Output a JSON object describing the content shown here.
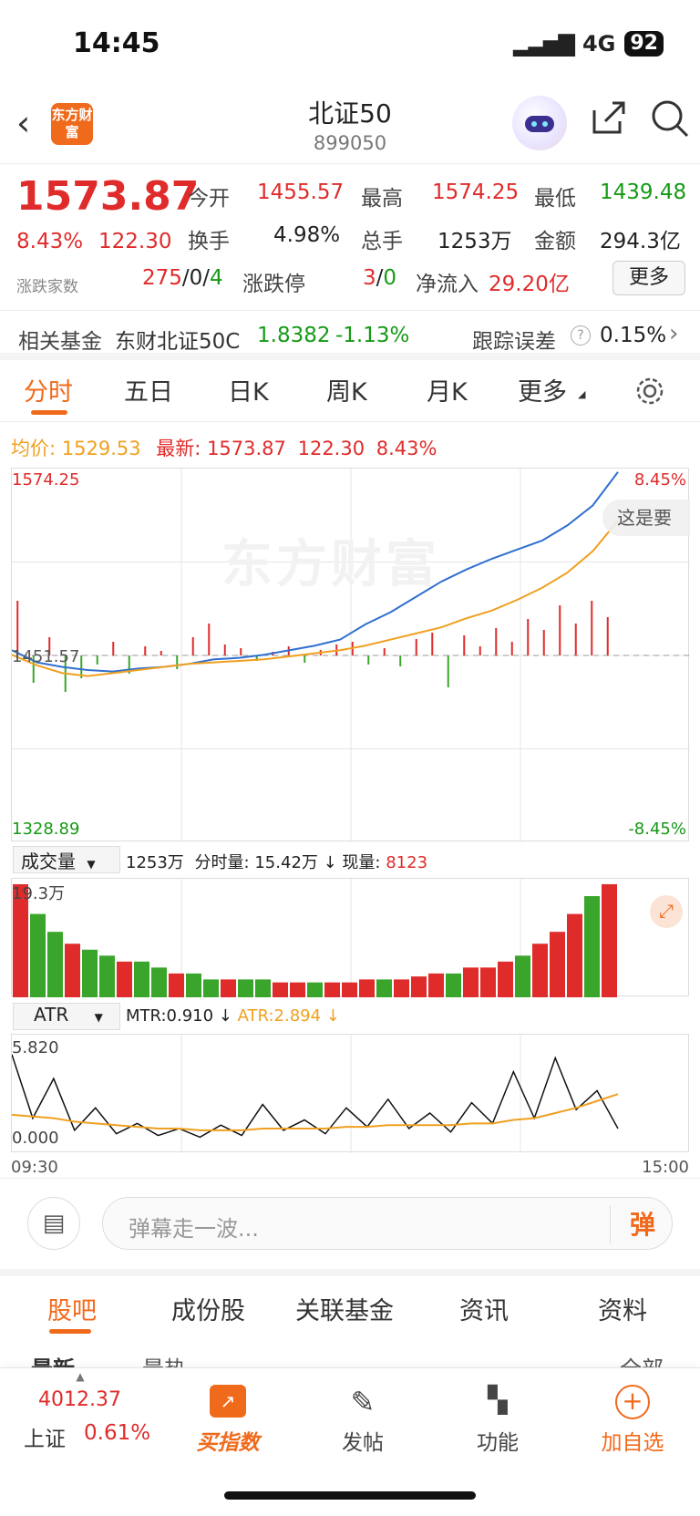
{
  "status_bar": {
    "time": "14:45",
    "network": "4G",
    "battery": "92"
  },
  "header": {
    "logo_text": "东方财富",
    "title": "北证50",
    "code": "899050"
  },
  "quote": {
    "price": "1573.87",
    "change_pct": "8.43%",
    "change": "122.30",
    "updown_count_label": "涨跌家数",
    "up": "275",
    "flat": "0",
    "down": "4",
    "limit_label": "涨跌停",
    "limit_up": "3",
    "limit_down": "0",
    "open_label": "今开",
    "open": "1455.57",
    "high_label": "最高",
    "high": "1574.25",
    "low_label": "最低",
    "low": "1439.48",
    "turnover_label": "换手",
    "turnover": "4.98%",
    "volume_label": "总手",
    "volume": "1253万",
    "amount_label": "金额",
    "amount": "294.3亿",
    "netflow_label": "净流入",
    "netflow": "29.20亿",
    "more_button": "更多"
  },
  "related_fund": {
    "label": "相关基金",
    "name": "东财北证50C",
    "nav": "1.8382",
    "change": "-1.13%",
    "tracking_label": "跟踪误差",
    "tracking_value": "0.15%"
  },
  "chart_tabs": [
    "分时",
    "五日",
    "日K",
    "周K",
    "月K",
    "更多"
  ],
  "legend": {
    "avg_label": "均价:",
    "avg": "1529.53",
    "latest_label": "最新:",
    "latest": "1573.87",
    "latest_change": "122.30",
    "latest_pct": "8.43%"
  },
  "main_chart": {
    "y_max": "1574.25",
    "y_min": "1328.89",
    "y_prev": "1451.57",
    "pct_max": "8.45%",
    "pct_min": "-8.45%",
    "watermark": "东方财富",
    "tooltip": "这是要"
  },
  "volume_panel": {
    "selector": "成交量",
    "total": "1253万",
    "minute_label": "分时量:",
    "minute_value": "15.42万",
    "current_label": "现量:",
    "current_value": "8123",
    "y_max": "19.3万"
  },
  "atr_panel": {
    "selector": "ATR",
    "mtr_label": "MTR:0.910",
    "atr_label": "ATR:2.894",
    "y_max": "5.820",
    "y_min": "0.000",
    "time_start": "09:30",
    "time_end": "15:00"
  },
  "comment": {
    "placeholder": "弹幕走一波...",
    "danmu": "弹"
  },
  "bottom_tabs": [
    "股吧",
    "成份股",
    "关联基金",
    "资讯",
    "资料"
  ],
  "sub_tabs": {
    "left1": "最新",
    "left2": "最热",
    "right": "全部"
  },
  "navbar": {
    "index_value": "4012.37",
    "index_name": "上证",
    "index_pct": "0.61%",
    "items": [
      "买指数",
      "发帖",
      "功能",
      "加自选"
    ]
  },
  "chart_data": [
    {
      "type": "line",
      "title": "",
      "x_range": [
        "09:30",
        "15:00"
      ],
      "ylim": [
        1328.89,
        1574.25
      ],
      "series": [
        {
          "name": "最新",
          "color": "#2f6fd0",
          "values": [
            1455,
            1447,
            1444,
            1442,
            1441,
            1443,
            1444,
            1446,
            1449,
            1450,
            1452,
            1455,
            1458,
            1462,
            1472,
            1480,
            1490,
            1500,
            1508,
            1515,
            1521,
            1527,
            1537,
            1550,
            1572
          ]
        },
        {
          "name": "均价",
          "color": "#f0a020",
          "values": [
            1452,
            1445,
            1440,
            1438,
            1440,
            1442,
            1444,
            1446,
            1447,
            1448,
            1449,
            1451,
            1453,
            1455,
            1458,
            1462,
            1466,
            1470,
            1476,
            1481,
            1488,
            1496,
            1506,
            1520,
            1540
          ]
        }
      ]
    },
    {
      "type": "bar",
      "title": "成交量",
      "ylim": [
        0,
        19.3
      ],
      "values": [
        19,
        14,
        11,
        9,
        8,
        7,
        6,
        6,
        5,
        4,
        4,
        3,
        3,
        3,
        3,
        2.5,
        2.5,
        2.5,
        2.5,
        2.5,
        3,
        3,
        3,
        3.5,
        4,
        4,
        5,
        5,
        6,
        7,
        9,
        11,
        14,
        17,
        19
      ]
    },
    {
      "type": "line",
      "title": "ATR",
      "ylim": [
        0,
        5.82
      ],
      "series": [
        {
          "name": "MTR",
          "values": [
            5.2,
            1.5,
            3.8,
            0.8,
            2.1,
            0.6,
            1.2,
            0.5,
            0.9,
            0.4,
            1.1,
            0.5,
            2.3,
            0.8,
            1.4,
            0.6,
            2.1,
            1.0,
            2.6,
            0.9,
            1.8,
            0.7,
            2.4,
            1.2,
            4.2,
            1.5,
            5.0,
            2.0,
            3.1,
            0.9
          ]
        },
        {
          "name": "ATR",
          "color": "#f0a020",
          "values": [
            1.7,
            1.6,
            1.5,
            1.3,
            1.2,
            1.1,
            1.0,
            0.9,
            0.9,
            0.8,
            0.8,
            0.8,
            0.9,
            0.9,
            0.9,
            0.9,
            1.0,
            1.0,
            1.1,
            1.1,
            1.1,
            1.1,
            1.2,
            1.2,
            1.4,
            1.5,
            1.8,
            2.1,
            2.5,
            2.9
          ]
        }
      ]
    }
  ]
}
